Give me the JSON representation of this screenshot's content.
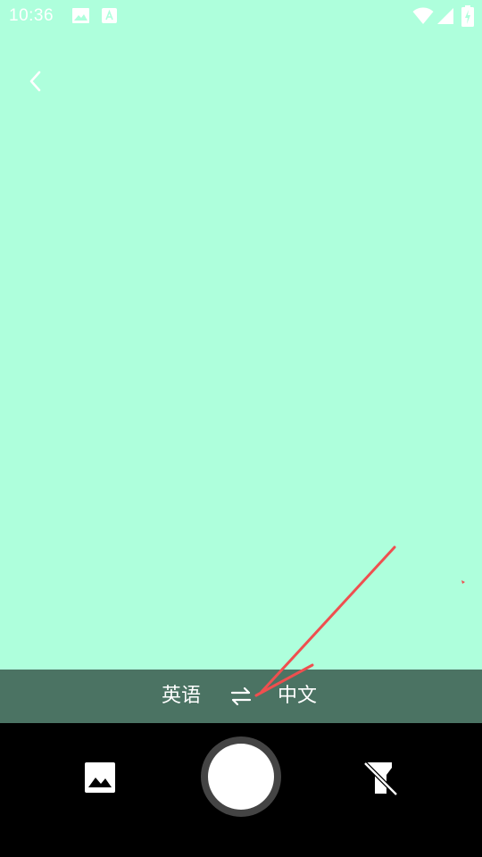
{
  "status_bar": {
    "time": "10:36",
    "icons": [
      "gallery-notification-icon",
      "a-notification-icon",
      "wifi-icon",
      "cell-signal-icon",
      "battery-charging-icon"
    ]
  },
  "header": {
    "back_icon": "chevron-left-icon"
  },
  "language_bar": {
    "source_language": "英语",
    "target_language": "中文",
    "swap_icon": "swap-arrows-icon"
  },
  "controls": {
    "gallery_icon": "image-icon",
    "shutter_icon": "shutter-icon",
    "flash_icon": "flash-off-icon"
  },
  "colors": {
    "camera_preview": "#aeffdc",
    "language_bar": "#4b7363",
    "controls_background": "#000000",
    "annotation_arrow": "#ef4f4f"
  }
}
